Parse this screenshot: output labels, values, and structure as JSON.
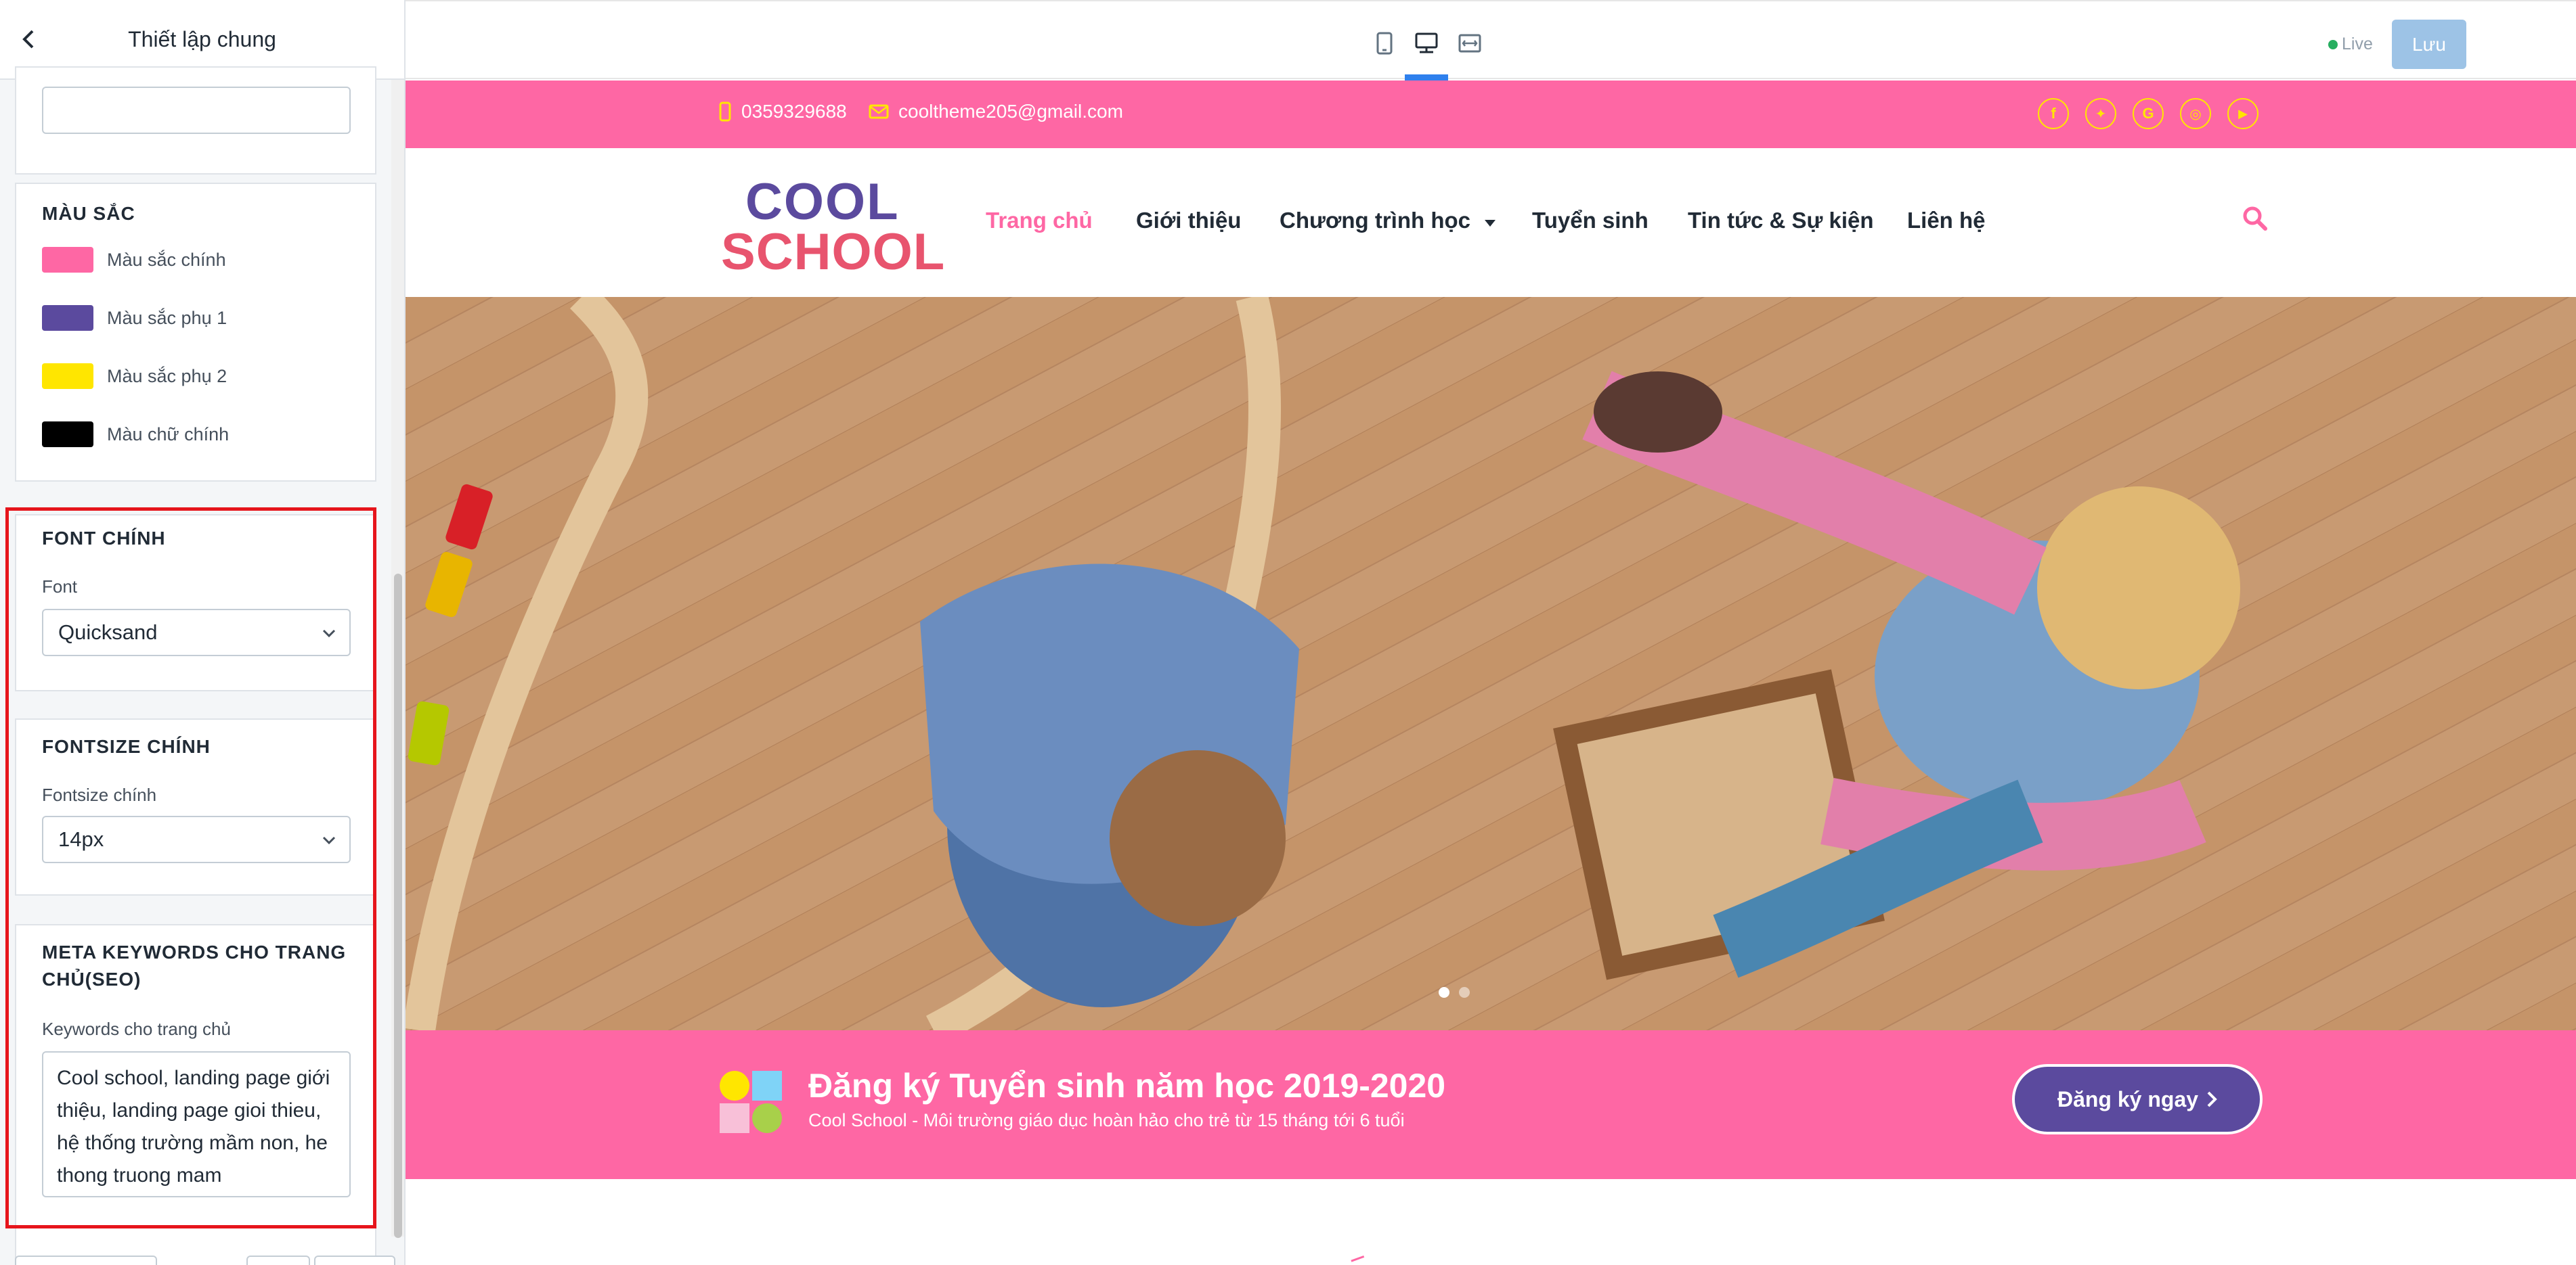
{
  "sidebar": {
    "title": "Thiết lập chung",
    "colors": {
      "heading": "MÀU SẮC",
      "items": [
        {
          "label": "Màu sắc chính",
          "color": "#fe67a4"
        },
        {
          "label": "Màu sắc phụ 1",
          "color": "#5b4a9e"
        },
        {
          "label": "Màu sắc phụ 2",
          "color": "#ffe600"
        },
        {
          "label": "Màu chữ chính",
          "color": "#000000"
        }
      ]
    },
    "font": {
      "heading": "FONT CHÍNH",
      "label": "Font",
      "value": "Quicksand"
    },
    "fontsize": {
      "heading": "FONTSIZE CHÍNH",
      "label": "Fontsize chính",
      "value": "14px"
    },
    "meta": {
      "heading": "META KEYWORDS CHO TRANG CHỦ(SEO)",
      "label": "Keywords cho trang chủ",
      "value": "Cool school, landing page giới thiệu, landing page gioi thieu, hệ thống trường mầm non, he thong truong mam"
    },
    "highlight_color": "#e6151c"
  },
  "toolbar": {
    "devices": [
      "mobile-icon",
      "desktop-icon",
      "fullwidth-icon"
    ],
    "active_device": "desktop-icon",
    "live_label": "Live",
    "save_label": "Lưu"
  },
  "site": {
    "accent": "#fe67a4",
    "phone": "0359329688",
    "email": "cooltheme205@gmail.com",
    "social": [
      "facebook-icon",
      "twitter-icon",
      "google-icon",
      "instagram-icon",
      "youtube-icon"
    ],
    "logo": {
      "line1": "COOL",
      "line2": "SCHOOL"
    },
    "nav": [
      {
        "label": "Trang chủ",
        "active": true
      },
      {
        "label": "Giới thiệu"
      },
      {
        "label": "Chương trình học",
        "dropdown": true
      },
      {
        "label": "Tuyển sinh"
      },
      {
        "label": "Tin tức & Sự kiện"
      },
      {
        "label": "Liên hệ"
      }
    ],
    "banner": {
      "title": "Đăng ký Tuyển sinh năm học 2019-2020",
      "subtitle": "Cool School - Môi trường giáo dục hoàn hảo cho trẻ từ 15 tháng tới 6 tuổi",
      "cta": "Đăng ký ngay"
    }
  }
}
